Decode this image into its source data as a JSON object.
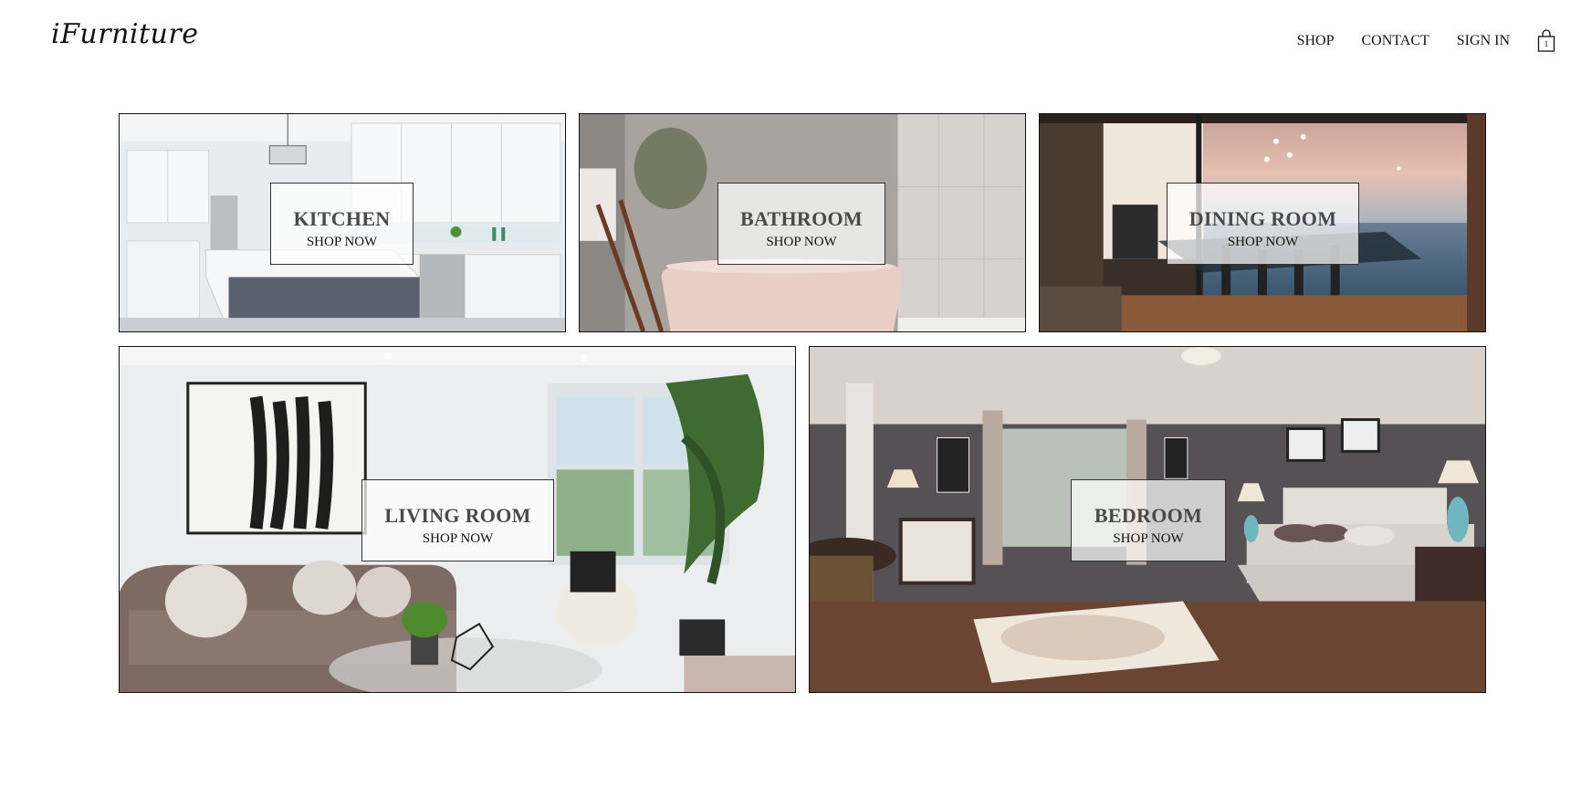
{
  "brand": {
    "logo": "iFurniture"
  },
  "nav": {
    "shop": "SHOP",
    "contact": "CONTACT",
    "sign_in": "SIGN IN",
    "cart_count": "1"
  },
  "categories": [
    {
      "title": "KITCHEN",
      "cta": "SHOP NOW"
    },
    {
      "title": "BATHROOM",
      "cta": "SHOP NOW"
    },
    {
      "title": "DINING ROOM",
      "cta": "SHOP NOW"
    },
    {
      "title": "LIVING ROOM",
      "cta": "SHOP NOW"
    },
    {
      "title": "BEDROOM",
      "cta": "SHOP NOW"
    }
  ],
  "colors": {
    "text": "#111111",
    "label_title": "#4a4a4a",
    "label_bg": "rgba(255,255,255,0.72)"
  }
}
